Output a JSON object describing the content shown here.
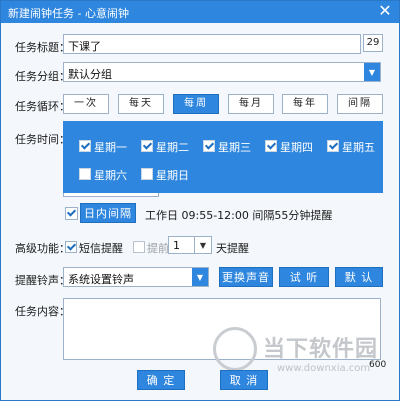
{
  "window": {
    "title": "新建闹钟任务 - 心意闹钟",
    "close_symbol": "✕"
  },
  "task_title": {
    "label": "任务标题：",
    "value": "下课了",
    "char_count": "29"
  },
  "task_group": {
    "label": "任务分组：",
    "value": "默认分组"
  },
  "task_cycle": {
    "label": "任务循环：",
    "tabs": [
      {
        "label": "一次",
        "active": false
      },
      {
        "label": "每天",
        "active": false
      },
      {
        "label": "每周",
        "active": true
      },
      {
        "label": "每月",
        "active": false
      },
      {
        "label": "每年",
        "active": false
      },
      {
        "label": "间隔",
        "active": false
      }
    ]
  },
  "task_time": {
    "label": "任务时间：",
    "days": [
      {
        "label": "星期一",
        "checked": true
      },
      {
        "label": "星期二",
        "checked": true
      },
      {
        "label": "星期三",
        "checked": true
      },
      {
        "label": "星期四",
        "checked": true
      },
      {
        "label": "星期五",
        "checked": true
      },
      {
        "label": "星期六",
        "checked": false
      },
      {
        "label": "星期日",
        "checked": false
      }
    ],
    "in_day_interval_label": "日内间隔",
    "work_info": "工作日 09:55-12:00 间隔55分钟提醒"
  },
  "advanced": {
    "label": "高级功能：",
    "sms_label": "短信提醒",
    "advance_label": "提前",
    "advance_value": "1",
    "days_label": "天提醒"
  },
  "ringtone": {
    "label": "提醒铃声：",
    "value": "系统设置铃声",
    "change_label": "更换声音",
    "listen_label": "试 听",
    "default_label": "默 认"
  },
  "content": {
    "label": "任务内容：",
    "char_count": "600"
  },
  "footer": {
    "ok_label": "确 定",
    "cancel_label": "取 消"
  },
  "watermark": {
    "text": "当下软件园",
    "url": "www.downxia.com"
  },
  "colors": {
    "accent": "#2e86de",
    "border": "#9cb2cb"
  }
}
